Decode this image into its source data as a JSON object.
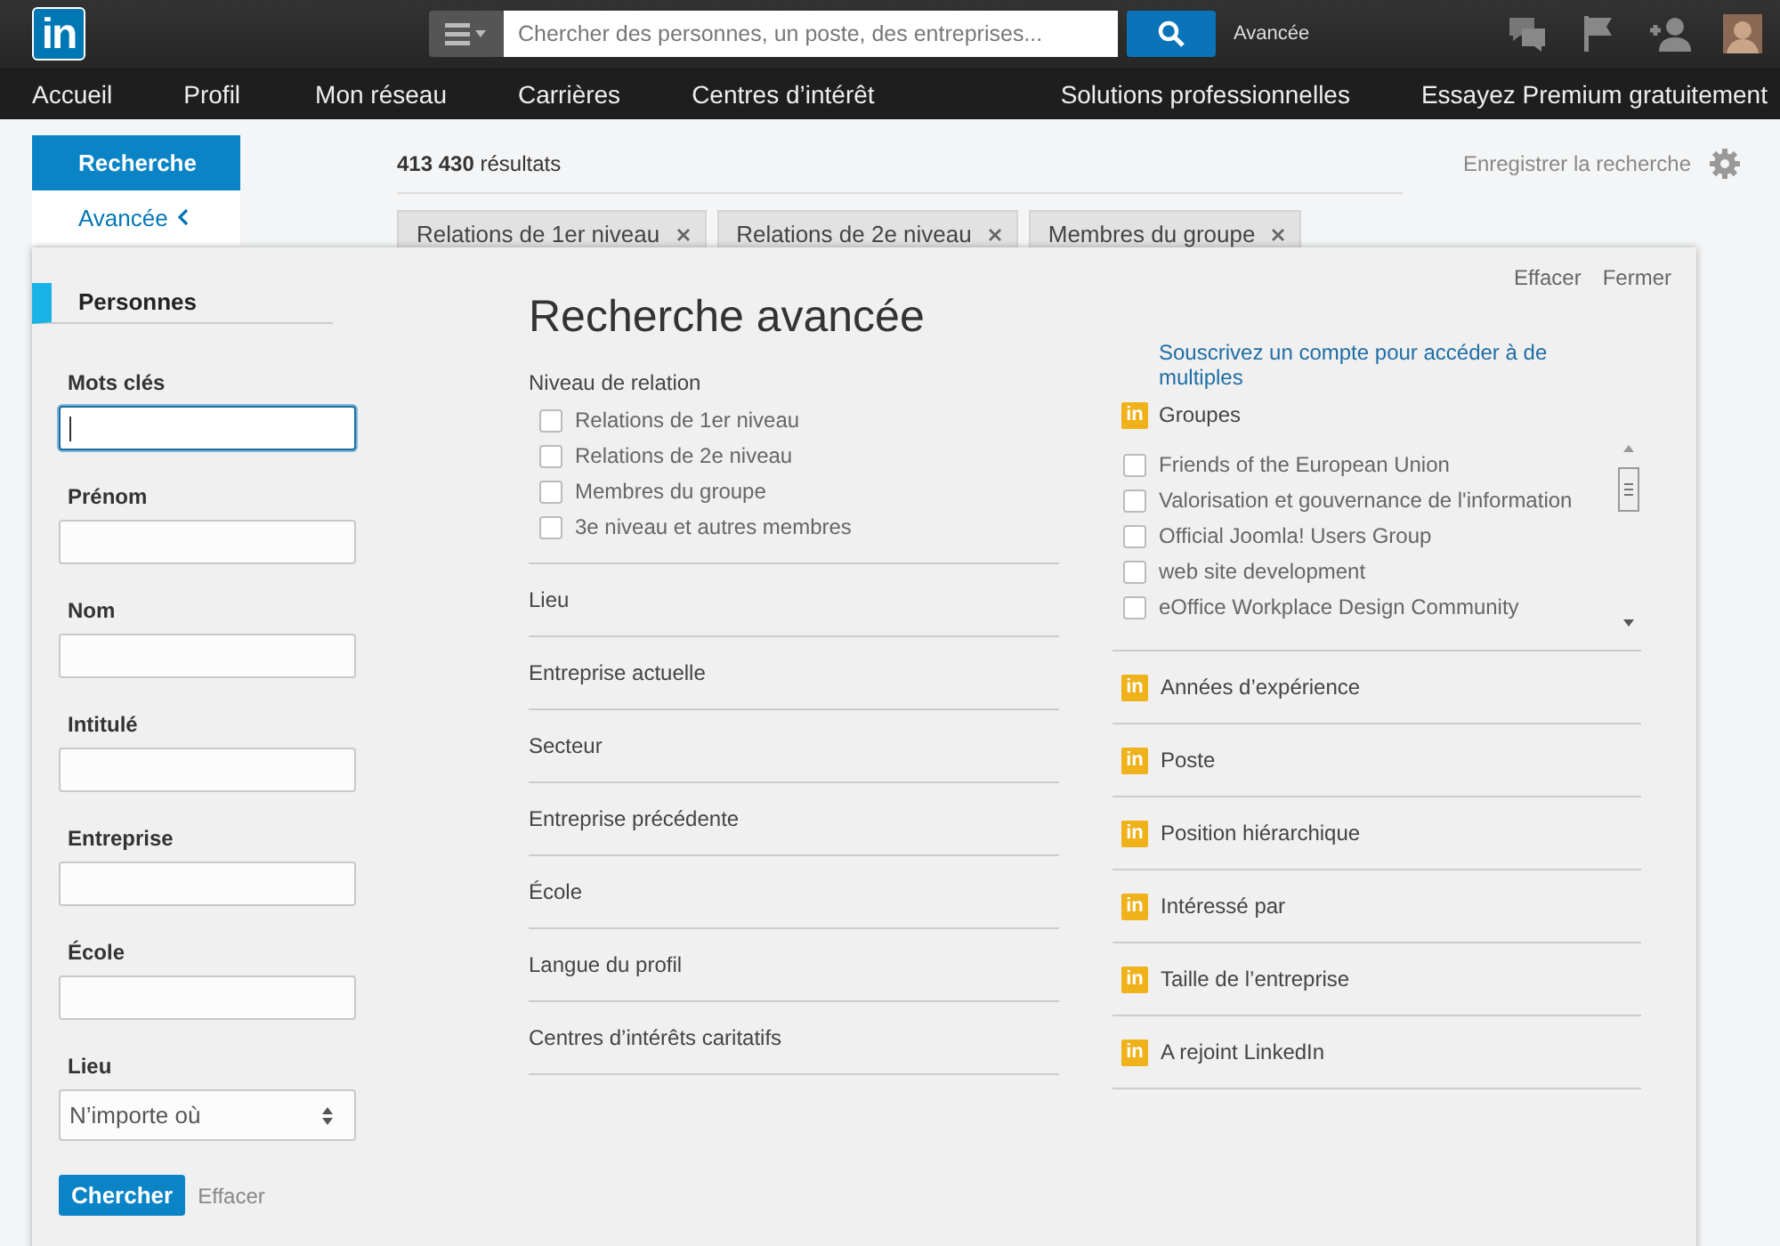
{
  "header": {
    "logo": "in",
    "search_placeholder": "Chercher des personnes, un poste, des entreprises...",
    "advanced_link": "Avancée"
  },
  "nav": {
    "left": [
      "Accueil",
      "Profil",
      "Mon réseau",
      "Carrières",
      "Centres d’intérêt"
    ],
    "right": [
      "Solutions professionnelles",
      "Essayez Premium gratuitement"
    ]
  },
  "sidebar": [
    {
      "label": "Recherche",
      "selected": true
    },
    {
      "label": "Avancée",
      "selected": false
    }
  ],
  "results": {
    "count": "413 430",
    "label": "résultats",
    "save": "Enregistrer la recherche"
  },
  "filter_chips": [
    "Relations de 1er niveau",
    "Relations de 2e niveau",
    "Membres du groupe"
  ],
  "panel": {
    "actions": [
      "Effacer",
      "Fermer"
    ],
    "title": "Recherche avancée",
    "tab": "Personnes",
    "fields": [
      {
        "label": "Mots clés",
        "kind": "text",
        "focused": true
      },
      {
        "label": "Prénom",
        "kind": "text",
        "focused": false
      },
      {
        "label": "Nom",
        "kind": "text",
        "focused": false
      },
      {
        "label": "Intitulé",
        "kind": "text",
        "focused": false
      },
      {
        "label": "Entreprise",
        "kind": "text",
        "focused": false
      },
      {
        "label": "École",
        "kind": "text",
        "focused": false
      },
      {
        "label": "Lieu",
        "kind": "select",
        "focused": false,
        "value": "N’importe où"
      }
    ],
    "submit": "Chercher",
    "clear": "Effacer"
  },
  "relation": {
    "label": "Niveau de relation",
    "options": [
      {
        "label": "Relations de 1er niveau",
        "checked": false
      },
      {
        "label": "Relations de 2e niveau",
        "checked": false
      },
      {
        "label": "Membres du groupe",
        "checked": false
      },
      {
        "label": "3e niveau et autres membres",
        "checked": false
      }
    ]
  },
  "facets": [
    "Lieu",
    "Entreprise actuelle",
    "Secteur",
    "Entreprise précédente",
    "École",
    "Langue du profil",
    "Centres d’intérêts caritatifs"
  ],
  "premium": {
    "upsell": "Souscrivez un compte pour accéder à de multiples",
    "groups": {
      "label": "Groupes",
      "badge": "in",
      "items": [
        {
          "label": "Friends of the European Union",
          "checked": false
        },
        {
          "label": "Valorisation et gouvernance de l'information",
          "checked": false
        },
        {
          "label": "Official Joomla! Users Group",
          "checked": false
        },
        {
          "label": "web site development",
          "checked": false
        },
        {
          "label": "eOffice Workplace Design Community",
          "checked": false
        }
      ]
    },
    "facets": [
      {
        "label": "Années d’expérience",
        "badge": "in"
      },
      {
        "label": "Poste",
        "badge": "in"
      },
      {
        "label": "Position hiérarchique",
        "badge": "in"
      },
      {
        "label": "Intéressé par",
        "badge": "in"
      },
      {
        "label": "Taille de l’entreprise",
        "badge": "in"
      },
      {
        "label": "A rejoint LinkedIn",
        "badge": "in"
      }
    ]
  }
}
